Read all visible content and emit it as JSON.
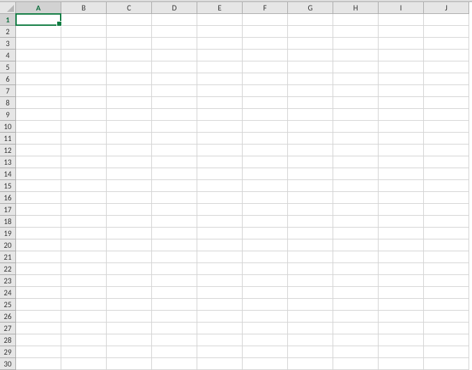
{
  "columns": [
    "A",
    "B",
    "C",
    "D",
    "E",
    "F",
    "G",
    "H",
    "I",
    "J"
  ],
  "rows": [
    "1",
    "2",
    "3",
    "4",
    "5",
    "6",
    "7",
    "8",
    "9",
    "10",
    "11",
    "12",
    "13",
    "14",
    "15",
    "16",
    "17",
    "18",
    "19",
    "20",
    "21",
    "22",
    "23",
    "24",
    "25",
    "26",
    "27",
    "28",
    "29",
    "30"
  ],
  "active_column_index": 0,
  "active_row_index": 0,
  "selected_cell": "A1",
  "cells": {}
}
